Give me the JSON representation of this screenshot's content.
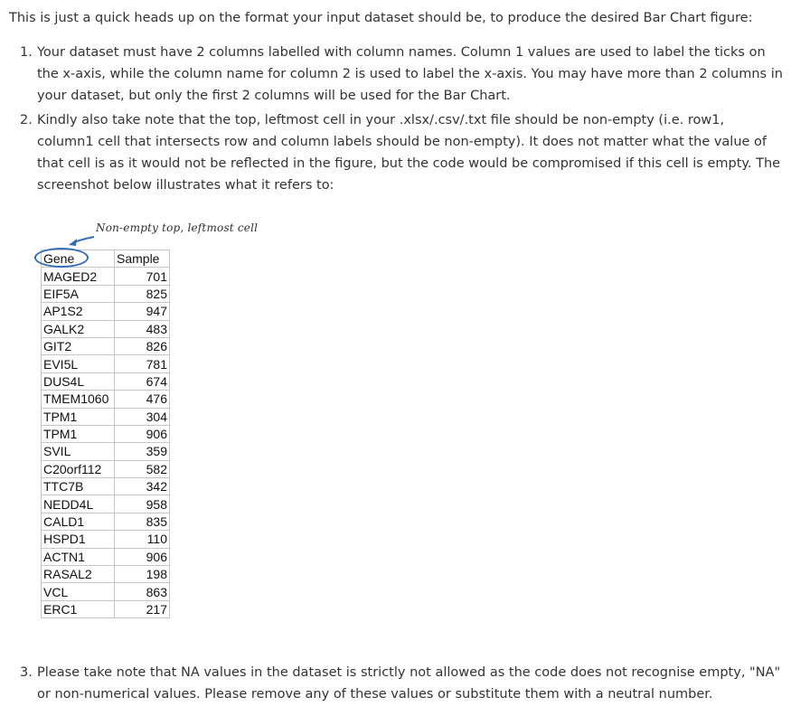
{
  "intro": "This is just a quick heads up on the format your input dataset should be, to produce the desired Bar Chart figure:",
  "items": [
    {
      "num": "1.",
      "text": "Your dataset must have 2 columns labelled with column names. Column 1 values are used to label the ticks on the x-axis, while the column name for column 2 is used to label the x-axis. You may have more than 2 columns in your dataset, but only the first 2 columns will be used for the Bar Chart."
    },
    {
      "num": "2.",
      "text": "Kindly also take note that the top, leftmost cell in your .xlsx/.csv/.txt file should be non-empty (i.e. row1, column1 cell that intersects row and column labels should be non-empty). It does not matter what the value of that cell is as it would not be reflected in the figure, but the code would be compromised if this cell is empty. The screenshot below illustrates what it refers to:"
    },
    {
      "num": "3.",
      "text": "Please take note that NA values in the dataset is strictly not allowed as the code does not recognise empty, \"NA\" or non-numerical values. Please remove any of these values or substitute them with a neutral number."
    }
  ],
  "illustration": {
    "annotation": "Non-empty top, leftmost cell",
    "header": [
      "Gene",
      "Sample"
    ],
    "rows": [
      [
        "MAGED2",
        "701"
      ],
      [
        "EIF5A",
        "825"
      ],
      [
        "AP1S2",
        "947"
      ],
      [
        "GALK2",
        "483"
      ],
      [
        "GIT2",
        "826"
      ],
      [
        "EVI5L",
        "781"
      ],
      [
        "DUS4L",
        "674"
      ],
      [
        "TMEM1060",
        "476"
      ],
      [
        "TPM1",
        "304"
      ],
      [
        "TPM1",
        "906"
      ],
      [
        "SVIL",
        "359"
      ],
      [
        "C20orf112",
        "582"
      ],
      [
        "TTC7B",
        "342"
      ],
      [
        "NEDD4L",
        "958"
      ],
      [
        "CALD1",
        "835"
      ],
      [
        "HSPD1",
        "110"
      ],
      [
        "ACTN1",
        "906"
      ],
      [
        "RASAL2",
        "198"
      ],
      [
        "VCL",
        "863"
      ],
      [
        "ERC1",
        "217"
      ]
    ],
    "accent_color": "#2f6fb7"
  }
}
